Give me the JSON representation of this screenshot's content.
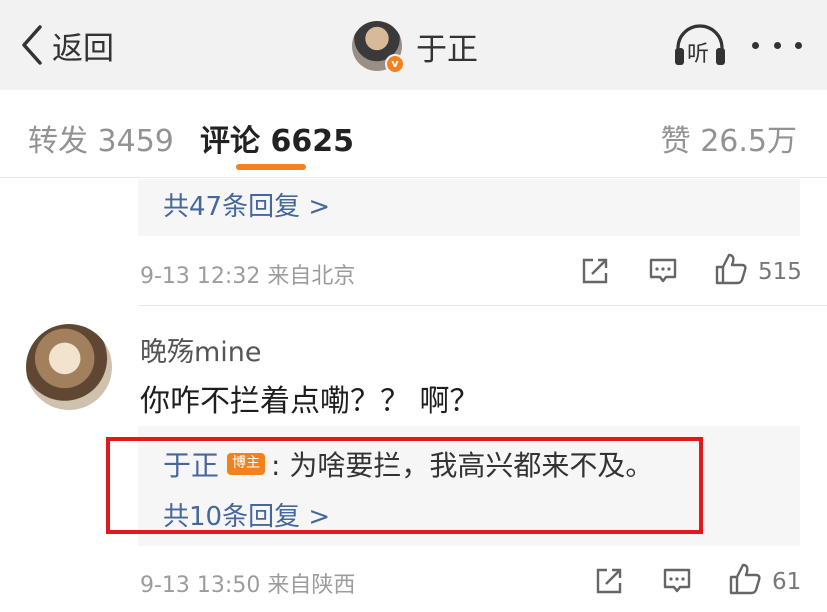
{
  "nav": {
    "back_label": "返回",
    "title": "于正",
    "listen_label": "听"
  },
  "tabs": {
    "repost": "转发 3459",
    "comment": "评论 6625",
    "like": "赞 26.5万"
  },
  "colors": {
    "accent": "#f48120",
    "link": "#45689c",
    "highlight_border": "#e0191f"
  },
  "prev_comment": {
    "reply_more": "共47条回复 >",
    "meta": "9-13 12:32 来自北京",
    "likes": "515"
  },
  "comment": {
    "username": "晚殇mine",
    "text": "你咋不拦着点嘞？？ 啊？",
    "reply": {
      "author": "于正",
      "badge": "博主",
      "text": ": 为啥要拦，我高兴都来不及。"
    },
    "reply_more": "共10条回复 >",
    "meta": "9-13 13:50 来自陕西",
    "likes": "61"
  },
  "icons": [
    "back-chevron-icon",
    "verified-badge-icon",
    "headphones-icon",
    "more-dots-icon",
    "share-icon",
    "comment-icon",
    "thumb-up-icon"
  ]
}
